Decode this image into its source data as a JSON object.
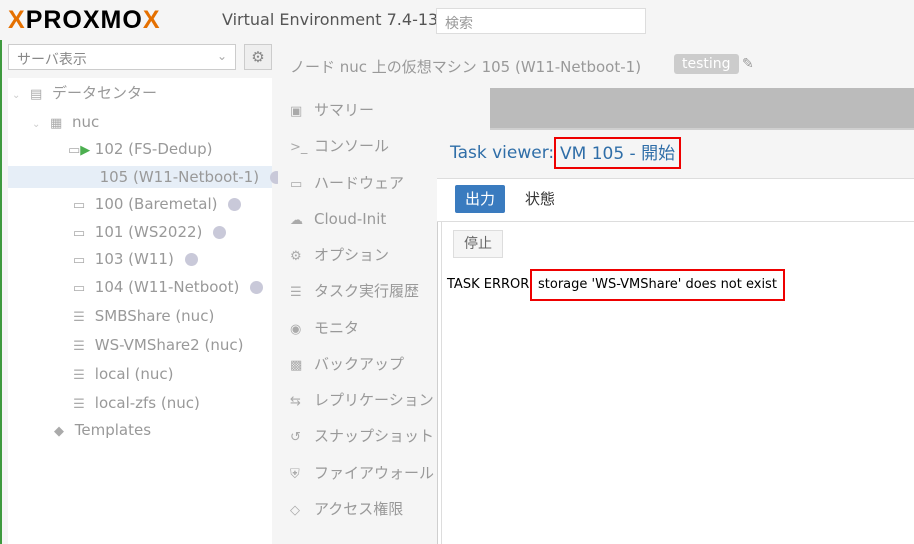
{
  "header": {
    "logo_x1": "X",
    "logo_text": "PROXMO",
    "logo_x2": "X",
    "version": "Virtual Environment 7.4-13",
    "search_placeholder": "検索"
  },
  "left": {
    "view_select": "サーバ表示",
    "tree": [
      {
        "label": "データセンター",
        "icon": "datacenter-icon"
      },
      {
        "label": "nuc",
        "icon": "node-icon"
      },
      {
        "label": "102 (FS-Dedup)",
        "icon": "vm-running-icon"
      },
      {
        "label": "105 (W11-Netboot-1)",
        "icon": "vm-icon"
      },
      {
        "label": "100 (Baremetal)",
        "icon": "vm-icon"
      },
      {
        "label": "101 (WS2022)",
        "icon": "vm-icon"
      },
      {
        "label": "103 (W11)",
        "icon": "vm-icon"
      },
      {
        "label": "104 (W11-Netboot)",
        "icon": "vm-icon"
      },
      {
        "label": "SMBShare (nuc)",
        "icon": "storage-icon"
      },
      {
        "label": "WS-VMShare2 (nuc)",
        "icon": "storage-icon"
      },
      {
        "label": "local (nuc)",
        "icon": "storage-icon"
      },
      {
        "label": "local-zfs (nuc)",
        "icon": "storage-icon"
      },
      {
        "label": "Templates",
        "icon": "tags-icon"
      }
    ]
  },
  "main": {
    "title": "ノード nuc 上の仮想マシン 105 (W11-Netboot-1)",
    "tag": "testing",
    "menu": [
      {
        "label": "サマリー",
        "icon": "book-icon"
      },
      {
        "label": "コンソール",
        "icon": "terminal-icon"
      },
      {
        "label": "ハードウェア",
        "icon": "desktop-icon"
      },
      {
        "label": "Cloud-Init",
        "icon": "cloud-icon"
      },
      {
        "label": "オプション",
        "icon": "gear-icon"
      },
      {
        "label": "タスク実行履歴",
        "icon": "list-icon"
      },
      {
        "label": "モニタ",
        "icon": "eye-icon"
      },
      {
        "label": "バックアップ",
        "icon": "floppy-icon"
      },
      {
        "label": "レプリケーション",
        "icon": "retweet-icon"
      },
      {
        "label": "スナップショット",
        "icon": "history-icon"
      },
      {
        "label": "ファイアウォール",
        "icon": "shield-icon"
      },
      {
        "label": "アクセス権限",
        "icon": "unlock-icon"
      }
    ]
  },
  "dialog": {
    "title_prefix": "Task viewer:",
    "title_main": "VM 105 - 開始",
    "tabs": {
      "output": "出力",
      "status": "状態"
    },
    "stop_button": "停止",
    "log_prefix": "TASK ERROR:",
    "log_message": "storage 'WS-VMShare' does not exist"
  },
  "colors": {
    "accent": "#3a7bbf",
    "logo_orange": "#e57000",
    "highlight": "#ee0000"
  }
}
